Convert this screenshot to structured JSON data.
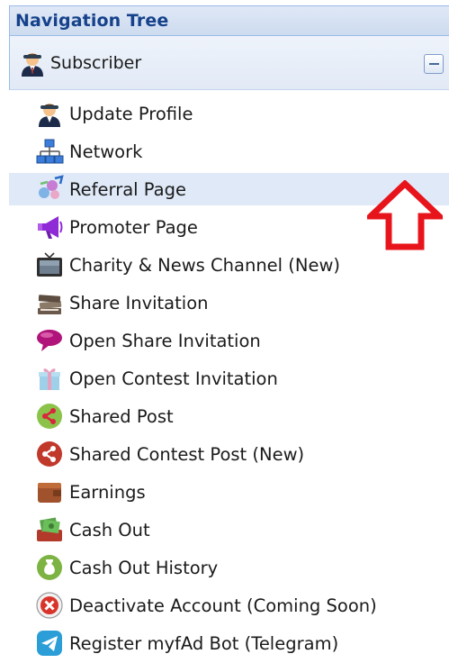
{
  "panel": {
    "title": "Navigation Tree"
  },
  "section": {
    "label": "Subscriber",
    "icon": "subscriber-icon"
  },
  "items": [
    {
      "label": "Update Profile",
      "icon": "user-profile-icon"
    },
    {
      "label": "Network",
      "icon": "network-icon"
    },
    {
      "label": "Referral Page",
      "icon": "referral-icon"
    },
    {
      "label": "Promoter Page",
      "icon": "megaphone-icon"
    },
    {
      "label": "Charity & News Channel (New)",
      "icon": "tv-icon"
    },
    {
      "label": "Share Invitation",
      "icon": "books-icon"
    },
    {
      "label": "Open Share Invitation",
      "icon": "speech-bubble-icon"
    },
    {
      "label": "Open Contest Invitation",
      "icon": "gift-icon"
    },
    {
      "label": "Shared Post",
      "icon": "share-green-icon"
    },
    {
      "label": "Shared Contest Post (New)",
      "icon": "share-red-icon"
    },
    {
      "label": "Earnings",
      "icon": "wallet-icon"
    },
    {
      "label": "Cash Out",
      "icon": "cash-icon"
    },
    {
      "label": "Cash Out History",
      "icon": "money-bag-icon"
    },
    {
      "label": "Deactivate Account (Coming Soon)",
      "icon": "close-circle-icon"
    },
    {
      "label": "Register myfAd Bot (Telegram)",
      "icon": "telegram-icon"
    }
  ],
  "selected_index": 2,
  "colors": {
    "header_text": "#15428b",
    "selected_bg": "#dfe9f7",
    "arrow": "#e8141c"
  }
}
